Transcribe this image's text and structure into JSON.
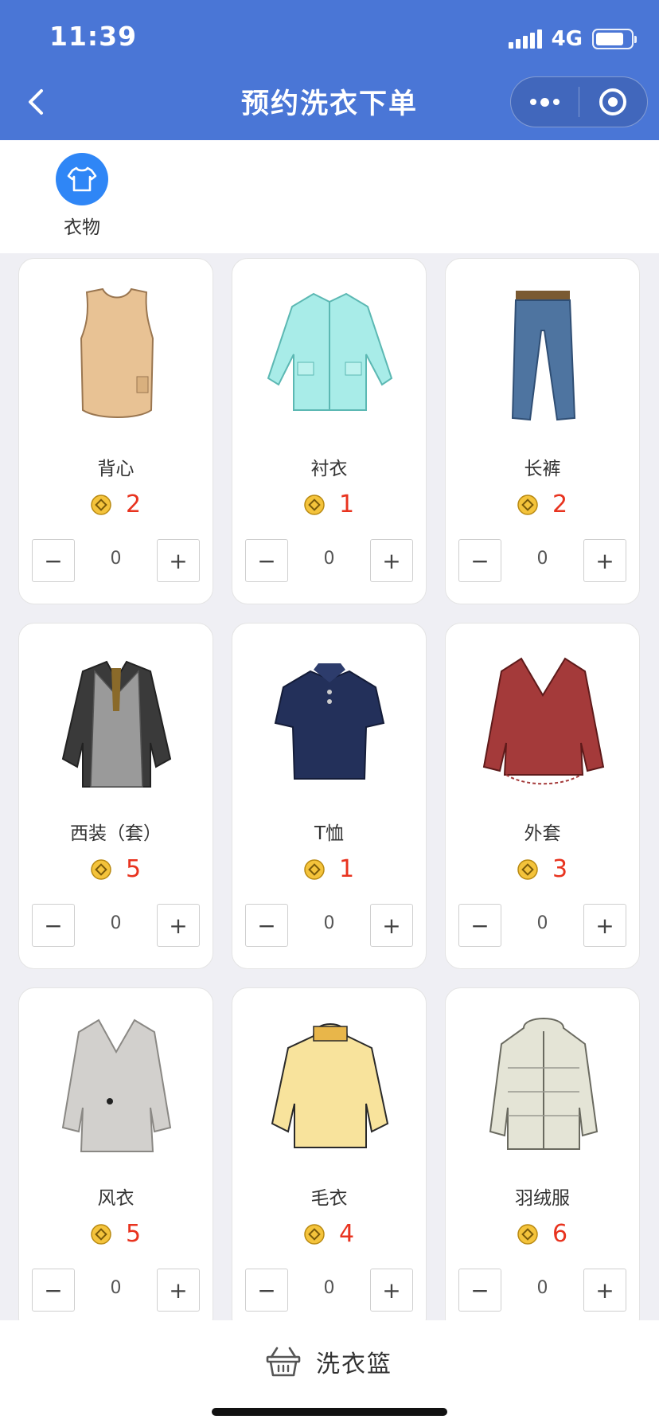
{
  "status_bar": {
    "time": "11:39",
    "network": "4G",
    "battery_level": 0.75
  },
  "nav": {
    "title": "预约洗衣下单"
  },
  "category": {
    "label": "衣物"
  },
  "items": [
    {
      "name": "背心",
      "price": "2",
      "qty": "0"
    },
    {
      "name": "衬衣",
      "price": "1",
      "qty": "0"
    },
    {
      "name": "长裤",
      "price": "2",
      "qty": "0"
    },
    {
      "name": "西装（套）",
      "price": "5",
      "qty": "0"
    },
    {
      "name": "T恤",
      "price": "1",
      "qty": "0"
    },
    {
      "name": "外套",
      "price": "3",
      "qty": "0"
    },
    {
      "name": "风衣",
      "price": "5",
      "qty": "0"
    },
    {
      "name": "毛衣",
      "price": "4",
      "qty": "0"
    },
    {
      "name": "羽绒服",
      "price": "6",
      "qty": "0"
    }
  ],
  "stepper": {
    "minus": "−",
    "plus": "+"
  },
  "bottom": {
    "basket_label": "洗衣篮"
  },
  "colors": {
    "header": "#4a76d6",
    "price": "#e8331f",
    "category": "#2f86f6"
  }
}
